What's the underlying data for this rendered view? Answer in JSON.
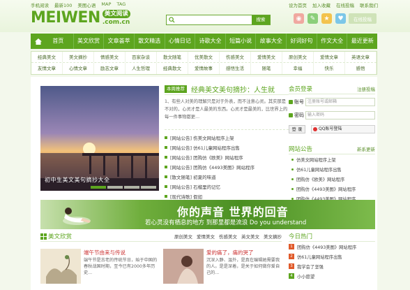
{
  "header": {
    "top_links": [
      "手机阅读",
      "最新100",
      "美图心语",
      "MAP",
      "TAG"
    ],
    "top_right": [
      "设为首页",
      "加入收藏",
      "在线投稿",
      "联系我们"
    ],
    "logo_text": "MEIWEN",
    "logo_badge": "美文阅读",
    "logo_domain": ".com.cn",
    "search_placeholder": "",
    "search_button": "搜索",
    "share_button": "在线投稿"
  },
  "nav": [
    "首页",
    "美文欣赏",
    "文章荟萃",
    "散文精选",
    "心情日记",
    "诗歌大全",
    "短篇小说",
    "故事大全",
    "好词好句",
    "作文大全",
    "最近更新"
  ],
  "subnav": [
    [
      "经典美文",
      "美文摘抄",
      "情感美文",
      "百家杂谈",
      "散文随笔",
      "优美散文",
      "伤感美文",
      "爱情美文",
      "原创美文",
      "爱情文章",
      "英语文章"
    ],
    [
      "友情文章",
      "心情文章",
      "励志文章",
      "人生哲理",
      "经典散文",
      "爱情故事",
      "感悟生活",
      "随笔",
      "幸福",
      "快乐",
      "感悟"
    ]
  ],
  "slider": {
    "caption": "初中生美文美句摘抄大全",
    "dots": 4,
    "active_dot": 0
  },
  "featured": {
    "tag": "本周推荐",
    "title": "经典美文美句摘抄：人生就",
    "summary": "1、有些人对美的理解只是对于外表，而不注意心灵。其实那是不对的，心灵才是人最美的东西。心灵才是最美的，比世界上的每一件事物都更...",
    "items": [
      "[网站公告] 伤美文网站程序上架",
      "[网站公告] 仿61儿童网站程序出售",
      "[网站公告] 团购仿《欧美》网站程序",
      "[网站公告] 团购仿《4493美图》网站程序",
      "[散文随笔] 初夏的味道",
      "[网站公告] 石榴里的记忆",
      "[现代诗歌] 假如"
    ]
  },
  "login": {
    "title": "会员登录",
    "register_link": "注册投稿",
    "account_label": "账号",
    "account_placeholder": "注册账号或邮箱",
    "password_label": "密码",
    "password_placeholder": "输入密码",
    "login_button": "登 录",
    "qq_button": "QQ账号登陆"
  },
  "notice": {
    "title": "网站公告",
    "more": "新系更新",
    "items": [
      "仿美文网站程序上架",
      "仿61儿童网站程序出售",
      "团购仿《欧美》网站程序",
      "团购仿《4493美图》网站程序",
      "团购仿《4493美图》网站程序"
    ]
  },
  "banner": {
    "headline": "你的声音 世界的回音",
    "subline": "若心灵没有栖息的地方 到那里都是流浪 Do you understand"
  },
  "section": {
    "title": "美文欣赏",
    "tabs": [
      "原创美文",
      "爱情美文",
      "伤感美文",
      "英文美文",
      "美文摘抄"
    ]
  },
  "cards": [
    {
      "title": "端午节由来与传说",
      "text": "端午节是古老的传统节日，始于中国的春秋战国时期，至今已有2000多年历史..."
    },
    {
      "title": "爱的痛了，痛的哭了",
      "text": "沉深入静、温外，是真在编辑她需要我的人。是是深着，是关于如何做你爱自己的..."
    }
  ],
  "hot": {
    "title": "今日热门",
    "items": [
      "团购仿《4493美图》网站程序",
      "仿61儿童网站程序出售",
      "我学会了坚强",
      "小小愿望"
    ]
  },
  "colors": {
    "brand_green": "#5da51f",
    "highlight_red": "#cc3333"
  }
}
